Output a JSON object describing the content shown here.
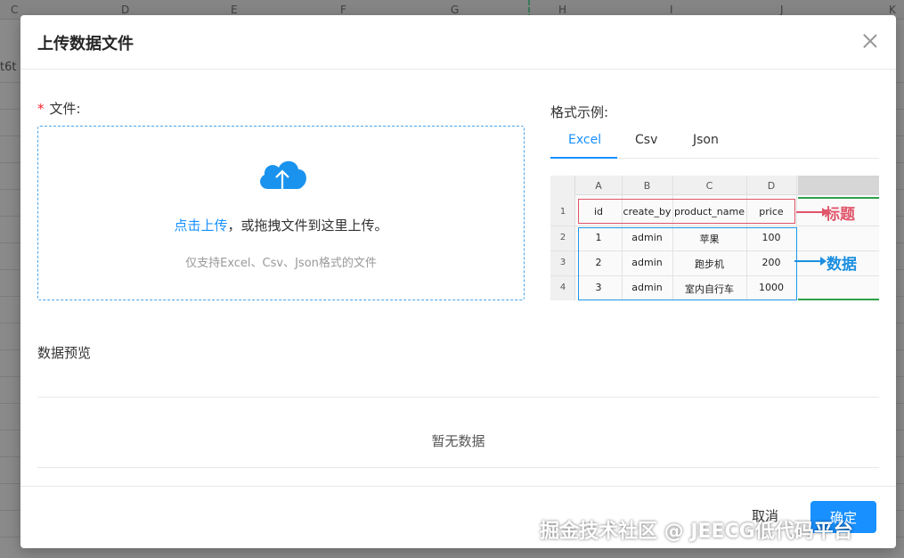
{
  "background": {
    "columns": [
      "C",
      "D",
      "E",
      "F",
      "G",
      "H",
      "I",
      "J",
      "K"
    ],
    "cell_text": "t6t"
  },
  "modal": {
    "title": "上传数据文件",
    "file_label": "文件:",
    "required_mark": "*",
    "upload": {
      "link_text": "点击上传",
      "rest_text": "，或拖拽文件到这里上传。",
      "hint": "仅支持Excel、Csv、Json格式的文件"
    },
    "example": {
      "label": "格式示例:",
      "tabs": [
        {
          "label": "Excel",
          "active": true
        },
        {
          "label": "Csv",
          "active": false
        },
        {
          "label": "Json",
          "active": false
        }
      ],
      "sheet": {
        "columns": [
          "A",
          "B",
          "C",
          "D"
        ],
        "rows": [
          "1",
          "2",
          "3",
          "4"
        ],
        "header": [
          "id",
          "create_by",
          "product_name",
          "price"
        ],
        "data": [
          [
            "1",
            "admin",
            "苹果",
            "100"
          ],
          [
            "2",
            "admin",
            "跑步机",
            "200"
          ],
          [
            "3",
            "admin",
            "室内自行车",
            "1000"
          ]
        ],
        "annotation_title": "标题",
        "annotation_data": "数据"
      }
    },
    "preview": {
      "label": "数据预览",
      "empty_text": "暂无数据"
    },
    "footer": {
      "cancel_label": "取消",
      "ok_label": "确定"
    }
  },
  "watermark": "掘金技术社区 @ JEECG低代码平台",
  "colors": {
    "primary": "#1890ff",
    "required": "#f5222d",
    "title_box": "#e0556a",
    "data_box": "#2196e8"
  }
}
